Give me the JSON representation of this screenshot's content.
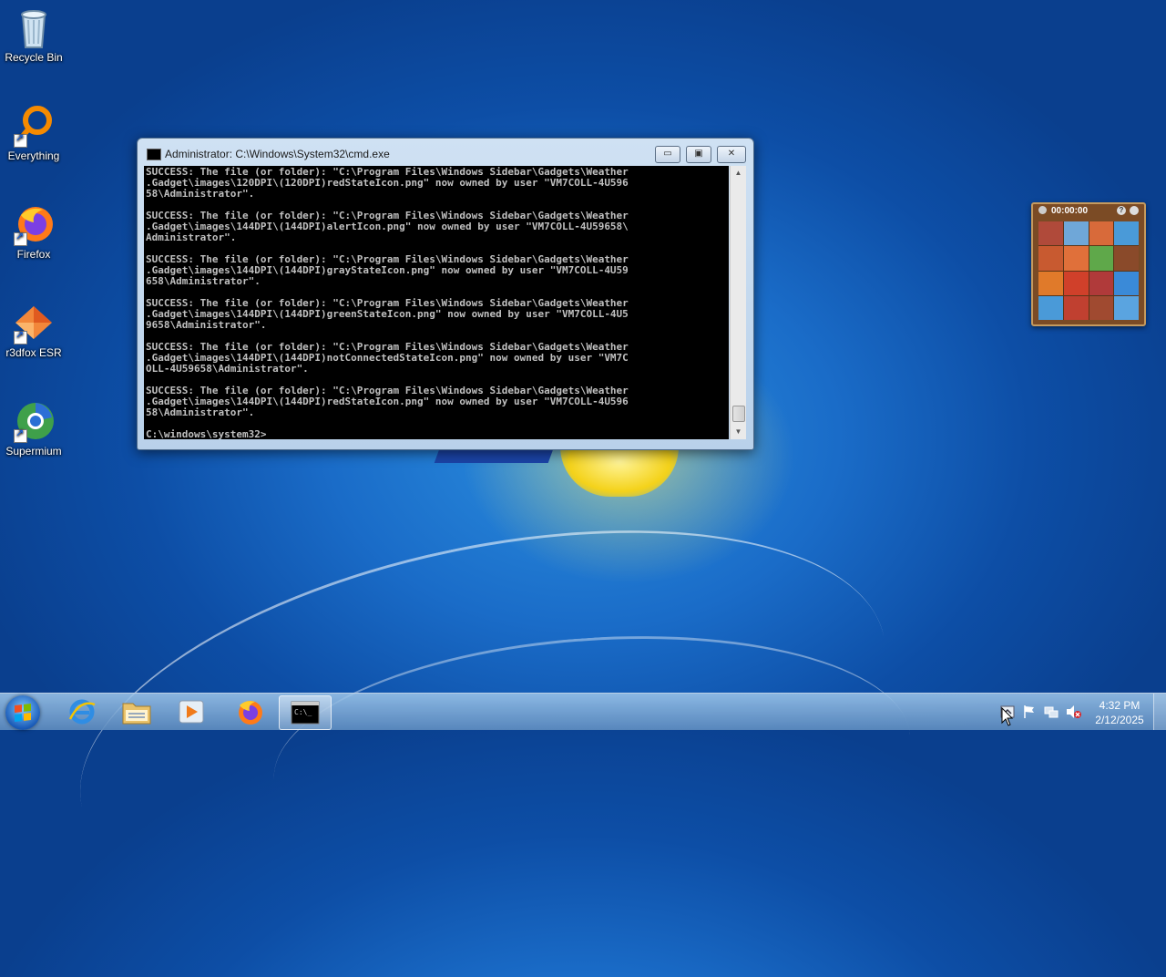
{
  "desktop": {
    "icons": [
      {
        "label": "Recycle Bin",
        "icon": "recycle-bin-icon"
      },
      {
        "label": "Everything",
        "icon": "everything-search-icon"
      },
      {
        "label": "Firefox",
        "icon": "firefox-icon"
      },
      {
        "label": "r3dfox ESR",
        "icon": "r3dfox-icon"
      },
      {
        "label": "Supermium",
        "icon": "supermium-icon"
      }
    ]
  },
  "cmd_window": {
    "title": "Administrator: C:\\Windows\\System32\\cmd.exe",
    "buttons": {
      "minimize": "▭",
      "maximize": "▣",
      "close": "✕"
    },
    "output": "SUCCESS: The file (or folder): \"C:\\Program Files\\Windows Sidebar\\Gadgets\\Weather\n.Gadget\\images\\120DPI\\(120DPI)redStateIcon.png\" now owned by user \"VM7COLL-4U596\n58\\Administrator\".\n\nSUCCESS: The file (or folder): \"C:\\Program Files\\Windows Sidebar\\Gadgets\\Weather\n.Gadget\\images\\144DPI\\(144DPI)alertIcon.png\" now owned by user \"VM7COLL-4U59658\\\nAdministrator\".\n\nSUCCESS: The file (or folder): \"C:\\Program Files\\Windows Sidebar\\Gadgets\\Weather\n.Gadget\\images\\144DPI\\(144DPI)grayStateIcon.png\" now owned by user \"VM7COLL-4U59\n658\\Administrator\".\n\nSUCCESS: The file (or folder): \"C:\\Program Files\\Windows Sidebar\\Gadgets\\Weather\n.Gadget\\images\\144DPI\\(144DPI)greenStateIcon.png\" now owned by user \"VM7COLL-4U5\n9658\\Administrator\".\n\nSUCCESS: The file (or folder): \"C:\\Program Files\\Windows Sidebar\\Gadgets\\Weather\n.Gadget\\images\\144DPI\\(144DPI)notConnectedStateIcon.png\" now owned by user \"VM7C\nOLL-4U59658\\Administrator\".\n\nSUCCESS: The file (or folder): \"C:\\Program Files\\Windows Sidebar\\Gadgets\\Weather\n.Gadget\\images\\144DPI\\(144DPI)redStateIcon.png\" now owned by user \"VM7COLL-4U596\n58\\Administrator\".\n\nC:\\windows\\system32>"
  },
  "gadget": {
    "timer": "00:00:00",
    "help": "?",
    "tile_colors": [
      "#b04a3a",
      "#6fa7d8",
      "#d86a3a",
      "#4a9ad8",
      "#c85a30",
      "#e0703a",
      "#5fa84a",
      "#8a4a2a",
      "#e07a2a",
      "#d0402a",
      "#b03a3a",
      "#3a8ad8",
      "#4a9ad8",
      "#c04030",
      "#a04a30",
      "#5aa4e0"
    ]
  },
  "taskbar": {
    "start_icon": "windows-start-icon",
    "pinned": [
      {
        "icon": "internet-explorer-icon",
        "active": false
      },
      {
        "icon": "file-explorer-icon",
        "active": false
      },
      {
        "icon": "media-player-icon",
        "active": false
      },
      {
        "icon": "firefox-icon",
        "active": false
      },
      {
        "icon": "command-prompt-icon",
        "active": true
      }
    ],
    "tray": [
      "show-hidden-icons-icon",
      "action-center-flag-icon",
      "network-icon",
      "volume-muted-icon"
    ],
    "time": "4:32 PM",
    "date": "2/12/2025"
  }
}
